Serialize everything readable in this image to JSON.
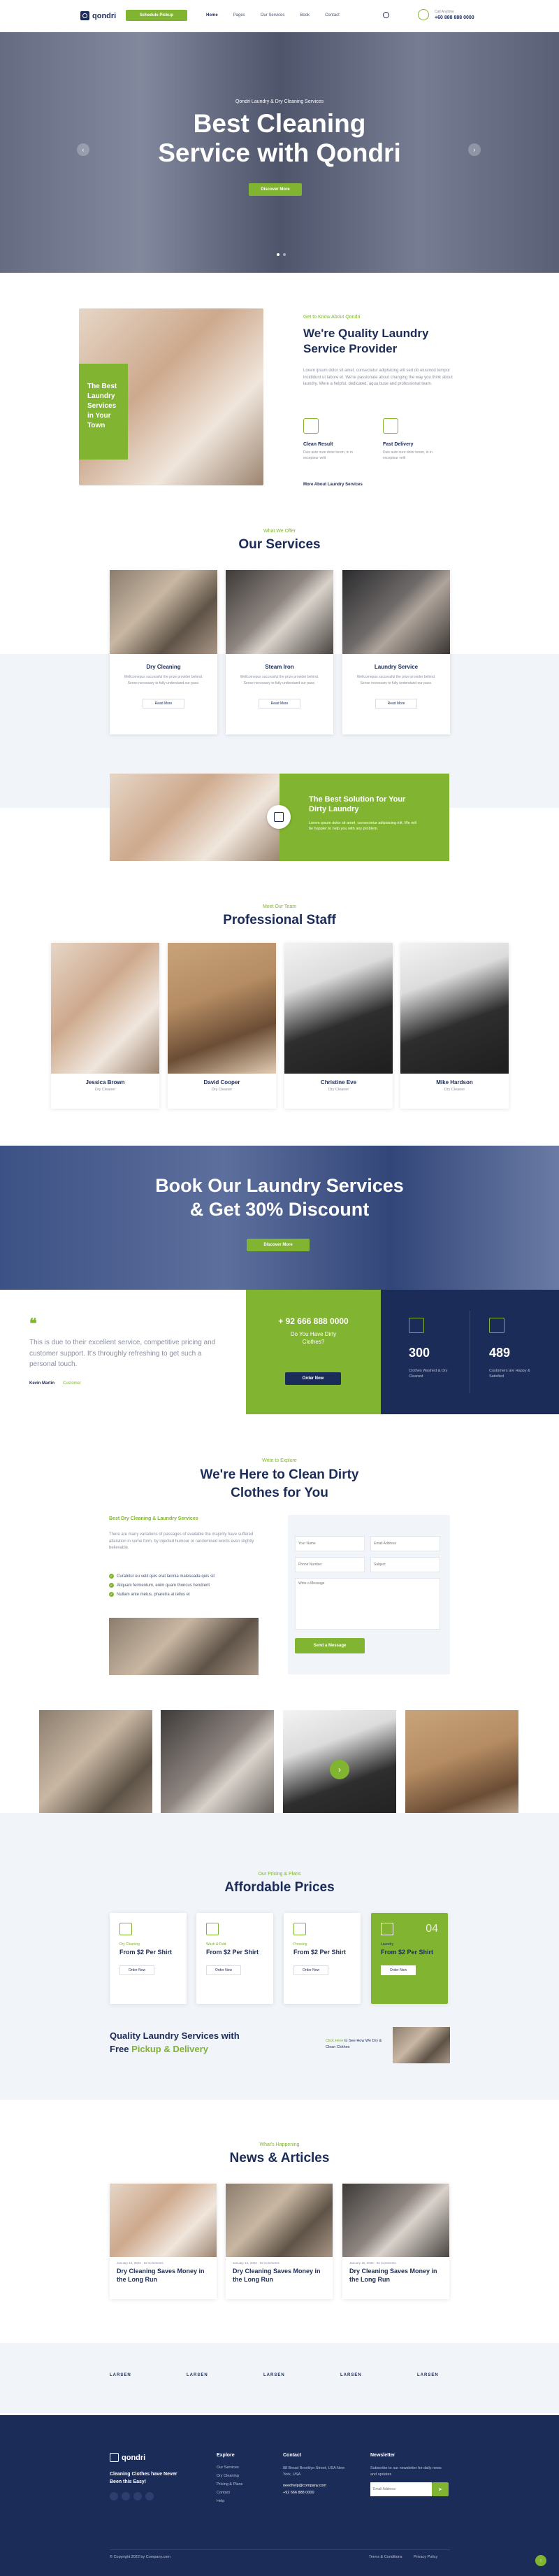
{
  "brand": {
    "name": "qondri",
    "accent": "#80b431",
    "navy": "#1c2c58"
  },
  "nav": {
    "cta": "Schedule Pickup",
    "items": [
      "Home",
      "Pages",
      "Our Services",
      "Book",
      "Contact"
    ],
    "call_label": "Call Anytime",
    "phone": "+60 888 888 0000"
  },
  "hero": {
    "subtitle": "Qondri Laundry & Dry Cleaning Services",
    "title_line1": "Best Cleaning",
    "title_line2": "Service with Qondri",
    "button": "Discover More"
  },
  "about": {
    "badge": "The Best Laundry Services in Your Town",
    "kicker": "Get to Know About Qondri",
    "title": "We're Quality Laundry Service Provider",
    "text": "Lorem ipsum dolor sit amet, consectetur adipisicing elit sed do eiusmod tempor incididunt ut labore et. We're passionate about changing the way you think about laundry. Were a helpful, dedicated, aqua buse and professional team.",
    "feature1_title": "Clean Result",
    "feature1_text": "Duis aute irure dolor lorem, in in excepteur velit",
    "feature2_title": "Fast Delivery",
    "feature2_text": "Duis aute irure dolor lorem, in in excepteur velit",
    "link": "More About Laundry Services"
  },
  "services": {
    "kicker": "What We Offer",
    "title": "Our Services",
    "items": [
      {
        "name": "Dry Cleaning",
        "desc": "Wellcomepus successful the prize provider behind. Sense necessary to fully understand our pace.",
        "button": "Read More"
      },
      {
        "name": "Steam Iron",
        "desc": "Wellcomepus successful the prize provider behind. Sense necessary to fully understand our pace.",
        "button": "Read More"
      },
      {
        "name": "Laundry Service",
        "desc": "Wellcomepus successful the prize provider behind. Sense necessary to fully understand our pace.",
        "button": "Read More"
      }
    ]
  },
  "solution": {
    "title": "The Best Solution for Your Dirty Laundry",
    "text": "Lorem ipsum dolor sit amet, consectetur adipisicing elit. We will be happier to help you with any problem."
  },
  "team": {
    "kicker": "Meet Our Team",
    "title": "Professional Staff",
    "members": [
      {
        "name": "Jessica Brown",
        "role": "Dry Cleaner"
      },
      {
        "name": "David Cooper",
        "role": "Dry Cleaner"
      },
      {
        "name": "Christine Eve",
        "role": "Dry Cleaner"
      },
      {
        "name": "Mike Hardson",
        "role": "Dry Cleaner"
      }
    ]
  },
  "discount": {
    "title_line1": "Book Our Laundry Services",
    "title_line2": "& Get 30% Discount",
    "button": "Discover More"
  },
  "testimonial": {
    "quote": "This is due to their excellent service, competitive pricing and customer support. It's throughly refreshing to get such a personal touch.",
    "author": "Kevin Martin",
    "author_role": "Customer"
  },
  "cta_box": {
    "phone": "+ 92 666 888 0000",
    "text": "Do You Have Dirty Clothes?",
    "button": "Order Now"
  },
  "stats": [
    {
      "value": "300",
      "label": "Clothes Washed & Dry Cleaned"
    },
    {
      "value": "489",
      "label": "Customers are Happy & Satisfied"
    }
  ],
  "contact": {
    "kicker": "Write to Explore",
    "title_line1": "We're Here to Clean Dirty",
    "title_line2": "Clothes for You",
    "subtitle": "Best Dry Cleaning & Laundry Services",
    "text": "There are many variations of passages of available the majority have suffered alteration in some form, by injected humour or randomised words even slightly believable.",
    "list": [
      "Curabitur eu velit quis erat lacinia malesuada quis sit",
      "Aliquam fermentum, enim quam thoncus hendrerit",
      "Nullam ante metus, pharetra at tellus et"
    ],
    "form": {
      "name": "Your Name",
      "email": "Email Address",
      "phone": "Phone Number",
      "subject": "Subject",
      "message": "Write a Message",
      "button": "Send a Message"
    }
  },
  "pricing": {
    "kicker": "Our Pricing & Plans",
    "title": "Affordable Prices",
    "plans": [
      {
        "label": "Dry Cleaning",
        "price": "From $2 Per Shirt",
        "button": "Order Now"
      },
      {
        "label": "Wash & Fold",
        "price": "From $2 Per Shirt",
        "button": "Order Now"
      },
      {
        "label": "Pressing",
        "price": "From $2 Per Shirt",
        "button": "Order Now"
      },
      {
        "label": "Laundry",
        "price": "From $2 Per Shirt",
        "button": "Order Now",
        "number": "04"
      }
    ],
    "banner_line1": "Quality Laundry Services with",
    "banner_free": "Free",
    "banner_pickup": "Pickup & Delivery",
    "banner_link": "Click Here",
    "banner_text": "to See How We Dry & Clean Clothes"
  },
  "news": {
    "kicker": "What's Happening",
    "title": "News & Articles",
    "items": [
      {
        "date": "January 16, 2022",
        "comments": "02 Comments",
        "title": "Dry Cleaning Saves Money in the Long Run"
      },
      {
        "date": "January 16, 2022",
        "comments": "02 Comments",
        "title": "Dry Cleaning Saves Money in the Long Run"
      },
      {
        "date": "January 16, 2022",
        "comments": "02 Comments",
        "title": "Dry Cleaning Saves Money in the Long Run"
      }
    ]
  },
  "logos": [
    "LARSEN",
    "LARSEN",
    "LARSEN",
    "LARSEN",
    "LARSEN"
  ],
  "footer": {
    "tagline": "Cleaning Clothes have Never Been this Easy!",
    "explore_title": "Explore",
    "explore": [
      "Our Services",
      "Dry Cleaning",
      "Pricing & Plans",
      "Contact",
      "Help"
    ],
    "contact_title": "Contact",
    "address": "88 Broad Brooklyn Street, USA New York, USA",
    "email": "needhelp@company.com",
    "phone": "+92 666 888 0000",
    "newsletter_title": "Newsletter",
    "newsletter_text": "Subscribe to our newsletter for daily news and updates",
    "email_placeholder": "Email Address",
    "copyright": "© Copyright 2022 by Company.com",
    "terms": "Terms & Conditions",
    "privacy": "Privacy Policy"
  }
}
